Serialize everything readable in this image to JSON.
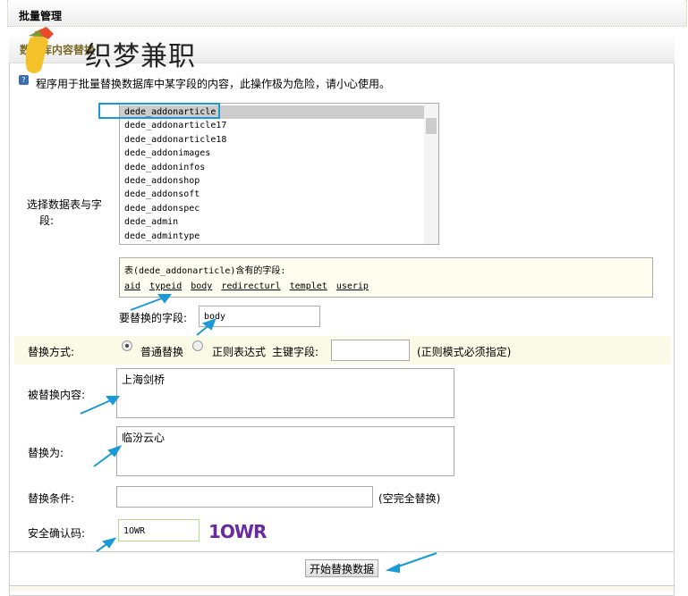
{
  "header": {
    "title": "批量管理"
  },
  "section": {
    "title": "数据库内容替换",
    "watermark": "织梦兼职"
  },
  "description": "程序用于批量替换数据库中某字段的内容，此操作极为危险，请小心使用。",
  "table_select": {
    "label": "选择数据表与字段:",
    "options": [
      "dede_addonarticle",
      "dede_addonarticle17",
      "dede_addonarticle18",
      "dede_addonimages",
      "dede_addoninfos",
      "dede_addonshop",
      "dede_addonsoft",
      "dede_addonspec",
      "dede_admin",
      "dede_admintype"
    ],
    "selected": "dede_addonarticle"
  },
  "fields": {
    "heading": "表(dede_addonarticle)含有的字段:",
    "items": [
      "aid",
      "typeid",
      "body",
      "redirecturl",
      "templet",
      "userip"
    ]
  },
  "field_input": {
    "label": "要替换的字段:",
    "value": "body"
  },
  "method": {
    "label": "替换方式:",
    "normal": "普通替换",
    "regex": "正则表达式",
    "key_label": "主键字段:",
    "key_value": "",
    "hint": "(正则模式必须指定)",
    "selected": "normal"
  },
  "find": {
    "label": "被替换内容:",
    "value": "上海剑桥"
  },
  "replace": {
    "label": "替换为:",
    "value": "临汾云心"
  },
  "condition": {
    "label": "替换条件:",
    "value": "",
    "hint": "(空完全替换)"
  },
  "captcha": {
    "label": "安全确认码:",
    "value": "1OWR",
    "image_text": "1OWR"
  },
  "submit": "开始替换数据",
  "colors": {
    "highlight_row": "#fbfae6",
    "annotation": "#1a9ad6"
  }
}
